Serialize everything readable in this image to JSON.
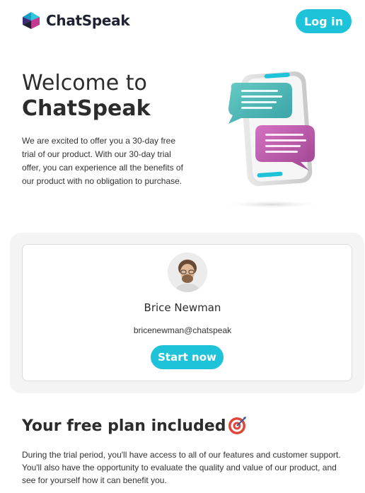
{
  "header": {
    "brand": "ChatSpeak",
    "login_label": "Log in"
  },
  "hero": {
    "title_line1": "Welcome to",
    "title_line2": "ChatSpeak",
    "body": "We are excited to offer you a 30-day free trial of our product. With our 30-day trial offer, you can experience all the benefits of our product with no obligation to purchase."
  },
  "profile": {
    "name": "Brice Newman",
    "email": "bricenewman@chatspeak",
    "cta_label": "Start now"
  },
  "plan": {
    "title": "Your free plan included",
    "body": "During the trial period, you'll have access to all of our features and customer support. You'll also have the opportunity to evaluate the quality and value of our product, and see for yourself how it can benefit you."
  },
  "colors": {
    "accent": "#1fc3d9",
    "teal_bubble": "#3fb3b0",
    "magenta_bubble": "#b84fa6",
    "card_bg": "#f4f4f4"
  },
  "icons": {
    "brand_logo": "chatspeak-logo-icon",
    "target": "target-icon"
  }
}
